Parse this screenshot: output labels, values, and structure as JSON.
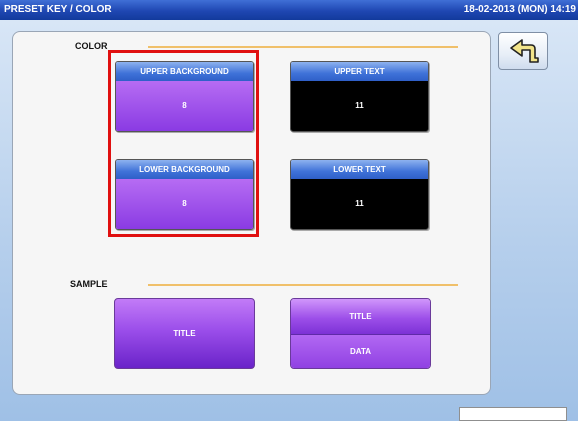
{
  "header": {
    "title": "PRESET KEY / COLOR",
    "datetime": "18-02-2013 (MON) 14:19"
  },
  "sections": {
    "color_label": "COLOR",
    "sample_label": "SAMPLE"
  },
  "color_keys": {
    "upper_background": {
      "label": "UPPER BACKGROUND",
      "value": "8"
    },
    "upper_text": {
      "label": "UPPER TEXT",
      "value": "11"
    },
    "lower_background": {
      "label": "LOWER BACKGROUND",
      "value": "8"
    },
    "lower_text": {
      "label": "LOWER TEXT",
      "value": "11"
    }
  },
  "sample": {
    "single_label": "TITLE",
    "double_title": "TITLE",
    "double_data": "DATA"
  },
  "icons": {
    "back": "return-arrow-icon"
  },
  "colors": {
    "highlight": "#e01010",
    "purple": "#8a3be3",
    "black": "#000000",
    "header_blue": "#1f47b2"
  }
}
